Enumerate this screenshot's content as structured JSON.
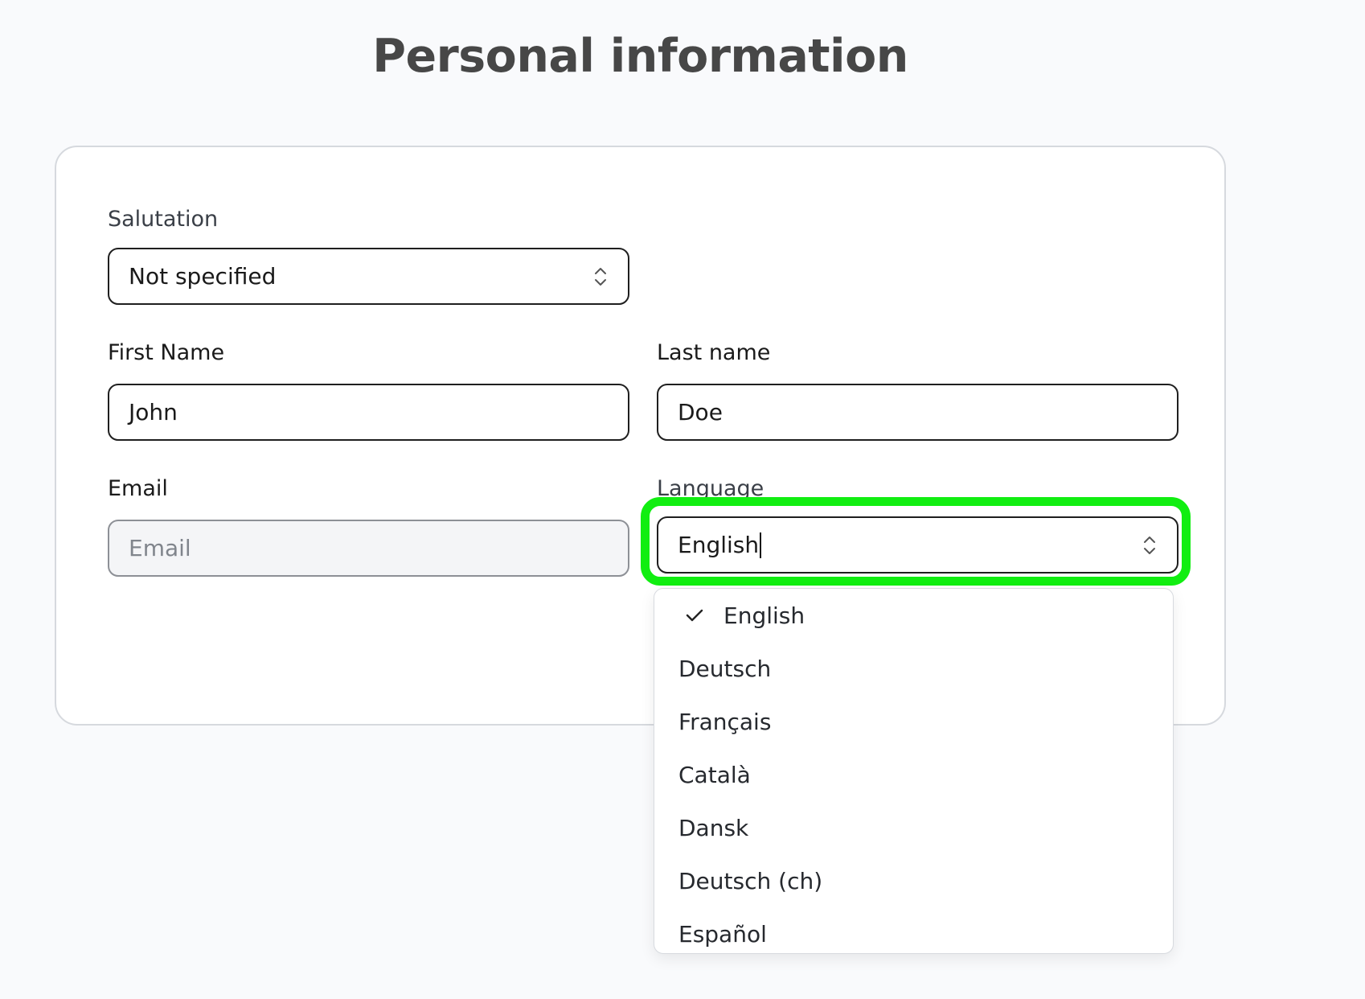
{
  "page": {
    "title": "Personal information"
  },
  "form": {
    "salutation": {
      "label": "Salutation",
      "value": "Not specified"
    },
    "first_name": {
      "label": "First Name",
      "value": "John"
    },
    "last_name": {
      "label": "Last name",
      "value": "Doe"
    },
    "email": {
      "label": "Email",
      "placeholder": "Email"
    },
    "language": {
      "label": "Language",
      "value": "English"
    }
  },
  "language_dropdown": {
    "options": [
      {
        "label": "English",
        "selected": true
      },
      {
        "label": "Deutsch",
        "selected": false
      },
      {
        "label": "Français",
        "selected": false
      },
      {
        "label": "Català",
        "selected": false
      },
      {
        "label": "Dansk",
        "selected": false
      },
      {
        "label": "Deutsch (ch)",
        "selected": false
      },
      {
        "label": "Español",
        "selected": false
      }
    ]
  },
  "colors": {
    "highlight": "#11ee11",
    "border": "#1f1f1f",
    "title": "#474747"
  },
  "icons": {
    "select_chevrons": "chevron-up-down-icon",
    "selected_check": "check-icon"
  }
}
